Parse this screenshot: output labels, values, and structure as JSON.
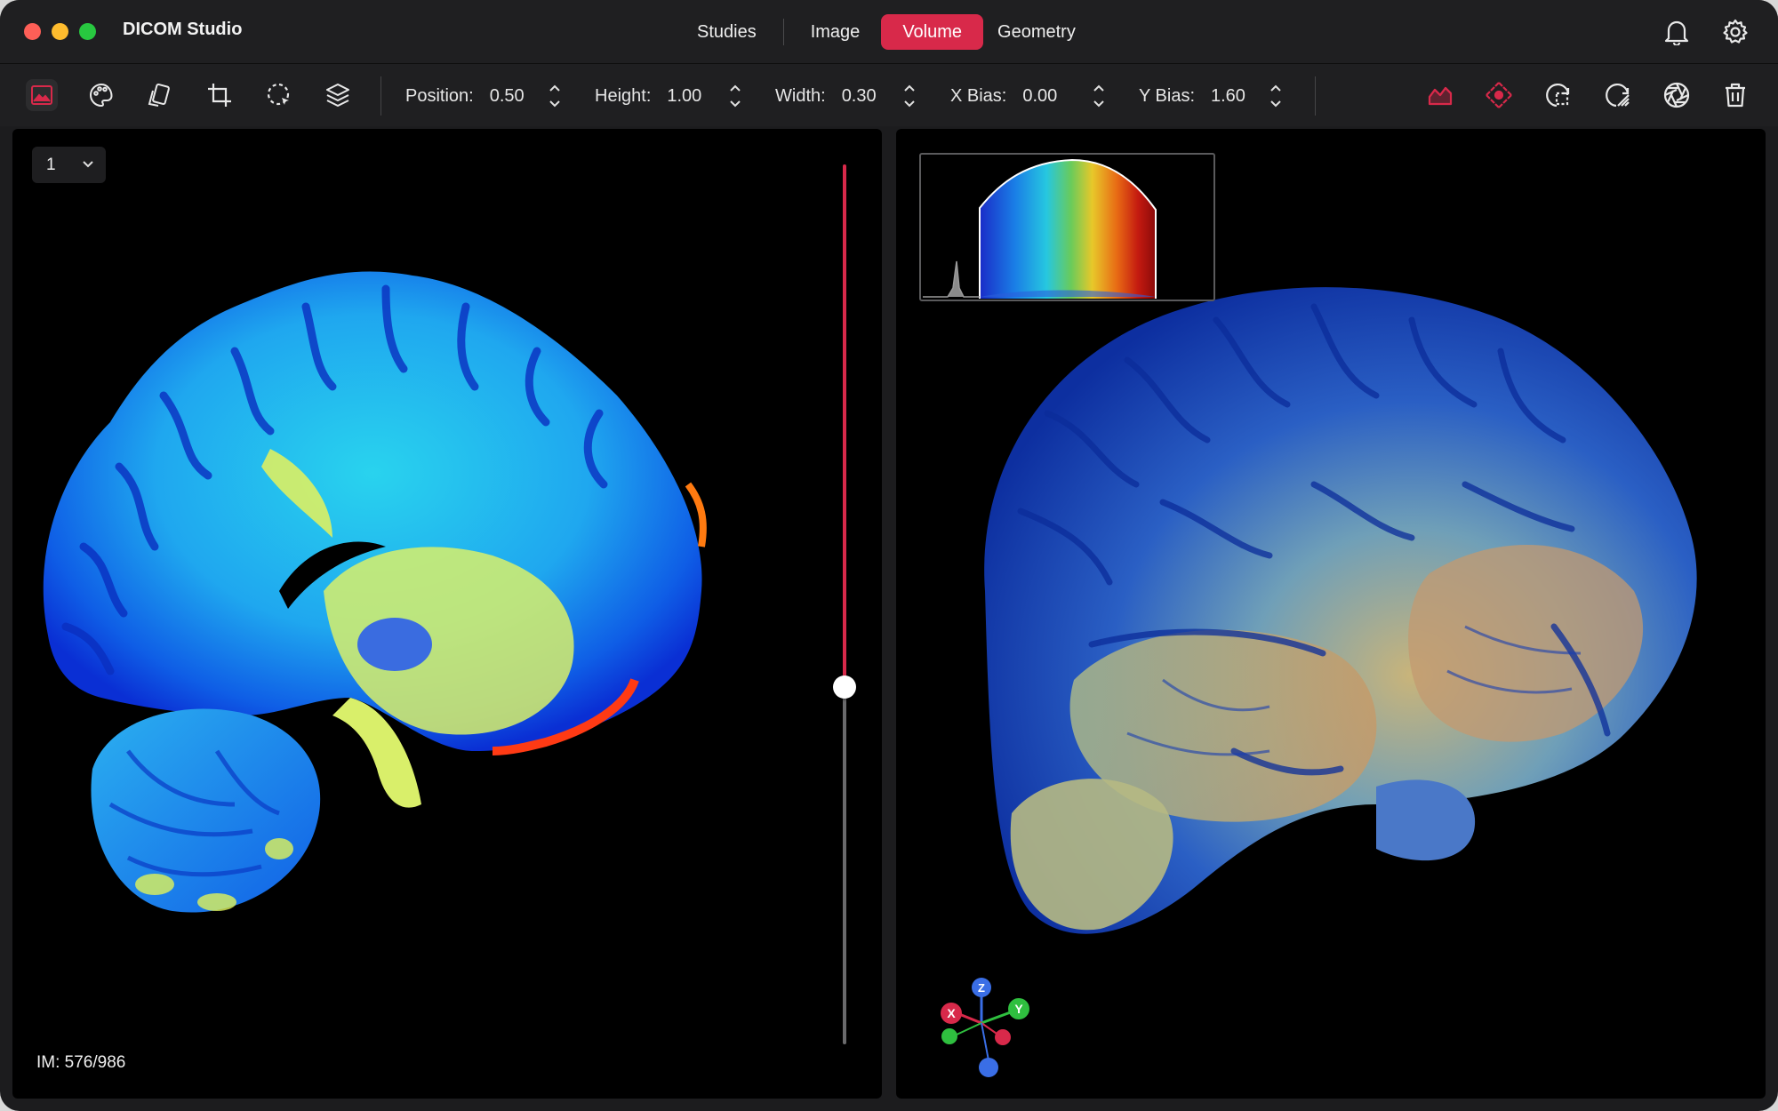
{
  "app": {
    "title": "DICOM Studio"
  },
  "tabs": [
    {
      "label": "Studies",
      "active": false
    },
    {
      "label": "Image",
      "active": false
    },
    {
      "label": "Volume",
      "active": true
    },
    {
      "label": "Geometry",
      "active": false
    }
  ],
  "header_icons": [
    "bell-icon",
    "gear-icon"
  ],
  "toolbar": {
    "left_tools": [
      "image-icon",
      "palette-icon",
      "cards-icon",
      "crop-icon",
      "lasso-icon",
      "layers-icon"
    ],
    "params": [
      {
        "label": "Position:",
        "value": "0.50"
      },
      {
        "label": "Height:",
        "value": "1.00"
      },
      {
        "label": "Width:",
        "value": "0.30"
      },
      {
        "label": "X Bias:",
        "value": "0.00"
      },
      {
        "label": "Y Bias:",
        "value": "1.60"
      }
    ],
    "right_tools": [
      "area-chart-icon",
      "move-target-icon",
      "rotate-select-icon",
      "rotate-hatch-icon",
      "aperture-icon",
      "trash-icon"
    ]
  },
  "left_panel": {
    "slice_select": "1",
    "slice_position_fraction": 0.584,
    "image_info": "IM: 576/986"
  },
  "right_panel": {
    "axes": {
      "x": "X",
      "y": "Y",
      "z": "Z"
    }
  },
  "colors": {
    "accent": "#d8294a",
    "background": "#1c1c1e",
    "panel": "#000000"
  }
}
